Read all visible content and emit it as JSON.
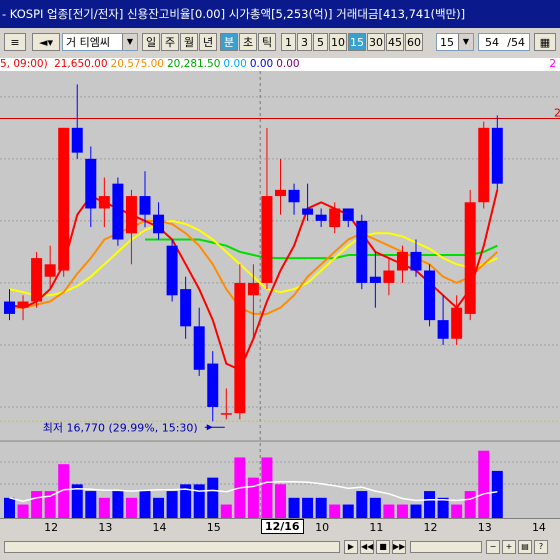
{
  "window": {
    "title": "- KOSPI 업종[전기/전자] 신용잔고비율[0.00] 시가총액[5,253(억)] 거래대금[413,741(백만)]"
  },
  "toolbar": {
    "search_value": "거 티엠씨",
    "period_tabs": [
      "일",
      "주",
      "월",
      "년"
    ],
    "intraday_tabs": [
      "분",
      "초",
      "틱"
    ],
    "interval_buttons": [
      "1",
      "3",
      "5",
      "10",
      "15",
      "30",
      "45",
      "60"
    ],
    "active_interval": "15",
    "interval_select": "15",
    "page_value": "54",
    "page_total": "/54"
  },
  "legend": {
    "prefix": "5, 09:00)",
    "values": [
      {
        "text": "21,650.00",
        "color": "#ff0000"
      },
      {
        "text": "20,575.00",
        "color": "#ff8c00"
      },
      {
        "text": "20,281.50",
        "color": "#00aa00"
      },
      {
        "text": "0.00",
        "color": "#00aaff"
      },
      {
        "text": "0.00",
        "color": "#0000ff"
      },
      {
        "text": "0.00",
        "color": "#800080"
      }
    ],
    "right_marker": "2"
  },
  "annotations": {
    "low_label": "최저 16,770 (29.99%, 15:30)",
    "right_high": "2"
  },
  "colors": {
    "up": "#ff0000",
    "down": "#0000ff",
    "ma5": "#ff0000",
    "ma10": "#ff8c00",
    "ma20": "#ffff00",
    "ma60": "#00dd00",
    "vol_up": "#ff00ff",
    "vol_down": "#0000ff",
    "vol_ma": "#ffffff"
  },
  "x_axis": {
    "labels": [
      {
        "text": "12",
        "bar": 3
      },
      {
        "text": "13",
        "bar": 7
      },
      {
        "text": "14",
        "bar": 11
      },
      {
        "text": "15",
        "bar": 15
      },
      {
        "text": "12/16",
        "bar": 19,
        "highlight": true
      },
      {
        "text": "10",
        "bar": 23
      },
      {
        "text": "11",
        "bar": 27
      },
      {
        "text": "12",
        "bar": 31
      },
      {
        "text": "13",
        "bar": 35
      },
      {
        "text": "14",
        "bar": 39
      }
    ]
  },
  "chart_data": {
    "type": "candlestick",
    "ylim": [
      16500,
      22400
    ],
    "high_line": 21650,
    "low_line": 16770,
    "candles": [
      {
        "o": 18700,
        "h": 18900,
        "l": 18400,
        "c": 18500
      },
      {
        "o": 18600,
        "h": 18800,
        "l": 18400,
        "c": 18700
      },
      {
        "o": 18700,
        "h": 19500,
        "l": 18600,
        "c": 19400
      },
      {
        "o": 19100,
        "h": 19600,
        "l": 18900,
        "c": 19300
      },
      {
        "o": 19200,
        "h": 21500,
        "l": 19100,
        "c": 21500
      },
      {
        "o": 21500,
        "h": 22200,
        "l": 21000,
        "c": 21100
      },
      {
        "o": 21000,
        "h": 21200,
        "l": 19900,
        "c": 20200
      },
      {
        "o": 20200,
        "h": 20700,
        "l": 19900,
        "c": 20400
      },
      {
        "o": 20600,
        "h": 20700,
        "l": 19600,
        "c": 19700
      },
      {
        "o": 19800,
        "h": 20500,
        "l": 19300,
        "c": 20400
      },
      {
        "o": 20400,
        "h": 20800,
        "l": 19900,
        "c": 20100
      },
      {
        "o": 20100,
        "h": 20300,
        "l": 19700,
        "c": 19800
      },
      {
        "o": 19600,
        "h": 19700,
        "l": 18700,
        "c": 18800
      },
      {
        "o": 18900,
        "h": 19100,
        "l": 18100,
        "c": 18300
      },
      {
        "o": 18300,
        "h": 18600,
        "l": 17500,
        "c": 17600
      },
      {
        "o": 17700,
        "h": 17900,
        "l": 16770,
        "c": 17000
      },
      {
        "o": 16900,
        "h": 17300,
        "l": 16800,
        "c": 16900
      },
      {
        "o": 16900,
        "h": 19300,
        "l": 16800,
        "c": 19000
      },
      {
        "o": 18800,
        "h": 19300,
        "l": 18100,
        "c": 19000
      },
      {
        "o": 19000,
        "h": 21500,
        "l": 18900,
        "c": 20400
      },
      {
        "o": 20400,
        "h": 21000,
        "l": 20100,
        "c": 20500
      },
      {
        "o": 20500,
        "h": 20600,
        "l": 20100,
        "c": 20300
      },
      {
        "o": 20200,
        "h": 20600,
        "l": 20000,
        "c": 20100
      },
      {
        "o": 20100,
        "h": 20200,
        "l": 19900,
        "c": 20000
      },
      {
        "o": 19900,
        "h": 20300,
        "l": 19800,
        "c": 20200
      },
      {
        "o": 20200,
        "h": 20200,
        "l": 19900,
        "c": 20000
      },
      {
        "o": 20000,
        "h": 20100,
        "l": 18900,
        "c": 19000
      },
      {
        "o": 19100,
        "h": 19500,
        "l": 18600,
        "c": 19000
      },
      {
        "o": 19000,
        "h": 19400,
        "l": 18800,
        "c": 19200
      },
      {
        "o": 19200,
        "h": 19600,
        "l": 19000,
        "c": 19500
      },
      {
        "o": 19500,
        "h": 19700,
        "l": 19100,
        "c": 19200
      },
      {
        "o": 19200,
        "h": 19300,
        "l": 18300,
        "c": 18400
      },
      {
        "o": 18400,
        "h": 18800,
        "l": 18000,
        "c": 18100
      },
      {
        "o": 18100,
        "h": 18800,
        "l": 18000,
        "c": 18600
      },
      {
        "o": 18500,
        "h": 20500,
        "l": 18400,
        "c": 20300
      },
      {
        "o": 20300,
        "h": 21600,
        "l": 20200,
        "c": 21500
      },
      {
        "o": 21500,
        "h": 21700,
        "l": 20500,
        "c": 20600
      }
    ],
    "ma5": [
      18650,
      18600,
      18700,
      18900,
      19300,
      20100,
      20400,
      20300,
      20200,
      20100,
      20000,
      19900,
      19700,
      19300,
      18900,
      18400,
      17700,
      17600,
      18100,
      18700,
      19200,
      19600,
      20200,
      20300,
      20200,
      20100,
      19800,
      19500,
      19400,
      19300,
      19200,
      19000,
      18800,
      18600,
      18900,
      19600,
      20500
    ],
    "ma10": [
      18600,
      18600,
      18650,
      18700,
      18850,
      19150,
      19400,
      19700,
      19800,
      19900,
      20000,
      20000,
      19950,
      19800,
      19600,
      19300,
      18900,
      18600,
      18500,
      18500,
      18600,
      18800,
      19100,
      19300,
      19500,
      19700,
      19800,
      19700,
      19600,
      19500,
      19400,
      19300,
      19100,
      19000,
      19100,
      19300,
      19500
    ],
    "ma20": [
      18900,
      18850,
      18800,
      18800,
      18850,
      18950,
      19100,
      19300,
      19500,
      19700,
      19850,
      19950,
      20000,
      19950,
      19850,
      19700,
      19500,
      19300,
      19100,
      18900,
      18850,
      18900,
      19000,
      19200,
      19400,
      19600,
      19750,
      19800,
      19800,
      19750,
      19650,
      19550,
      19400,
      19300,
      19250,
      19300,
      19400
    ],
    "ma60": [
      null,
      null,
      null,
      null,
      null,
      null,
      null,
      null,
      null,
      null,
      19700,
      19700,
      19700,
      19700,
      19700,
      19650,
      19600,
      19500,
      19450,
      19400,
      19400,
      19400,
      19400,
      19400,
      19400,
      19450,
      19450,
      19450,
      19450,
      19450,
      19450,
      19450,
      19450,
      19450,
      19450,
      19500,
      19600
    ],
    "volume": [
      3,
      2,
      4,
      4,
      8,
      5,
      4,
      3,
      4,
      3,
      4,
      3,
      4,
      5,
      5,
      6,
      2,
      9,
      6,
      9,
      5,
      3,
      3,
      3,
      2,
      2,
      4,
      3,
      2,
      2,
      2,
      4,
      3,
      2,
      4,
      10,
      7
    ]
  }
}
